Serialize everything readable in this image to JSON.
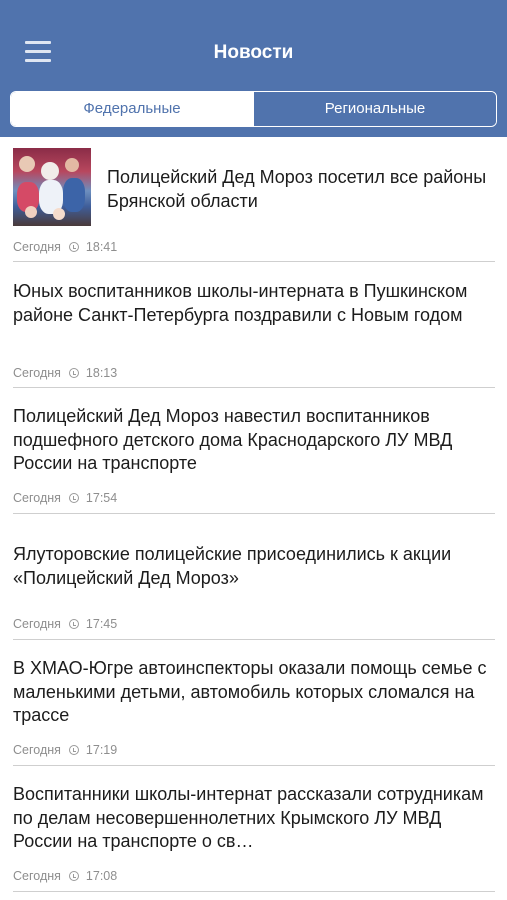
{
  "header": {
    "title": "Новости",
    "menu_icon": "hamburger-menu-icon"
  },
  "tabs": {
    "federal": "Федеральные",
    "regional": "Региональные",
    "active": "federal"
  },
  "colors": {
    "brand": "#5073ad",
    "divider": "#cfcfcf",
    "meta": "#8e8e8e"
  },
  "news": [
    {
      "headline": "Полицейский Дед Мороз посетил все районы Брянской области",
      "day": "Сегодня",
      "time": "18:41",
      "has_image": true
    },
    {
      "headline": "Юных воспитанников школы-интерната в Пушкинском районе Санкт-Петербурга поздравили с Новым годом",
      "day": "Сегодня",
      "time": "18:13"
    },
    {
      "headline": "Полицейский Дед Мороз навестил воспитанников подшефного детского дома Краснодарского ЛУ МВД России на транспорте",
      "day": "Сегодня",
      "time": "17:54"
    },
    {
      "headline": "Ялуторовские полицейские присоединились к акции «Полицейский Дед Мороз»",
      "day": "Сегодня",
      "time": "17:45"
    },
    {
      "headline": "В ХМАО-Югре автоинспекторы оказали помощь семье с маленькими детьми, автомобиль которых сломался на трассе",
      "day": "Сегодня",
      "time": "17:19"
    },
    {
      "headline": "Воспитанники школы-интернат рассказали сотрудникам по делам несовершеннолетних Крымского ЛУ МВД России на транспорте о св…",
      "day": "Сегодня",
      "time": "17:08"
    }
  ]
}
